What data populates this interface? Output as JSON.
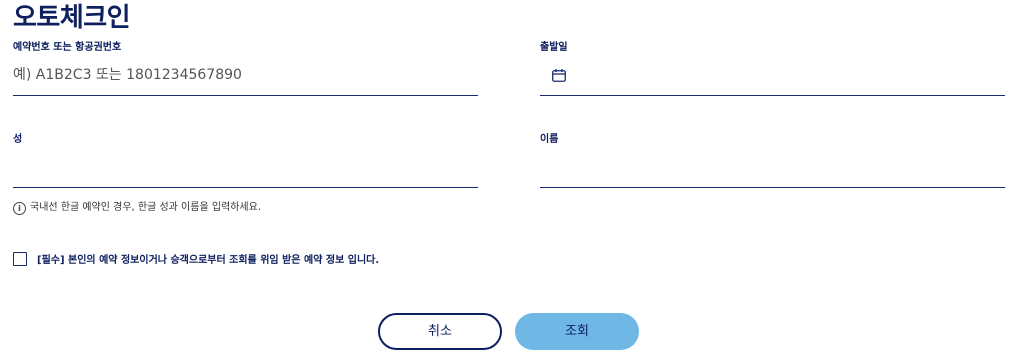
{
  "header": {
    "title": "오토체크인"
  },
  "form": {
    "reservation": {
      "label": "예약번호 또는 항공권번호",
      "placeholder": "예) A1B2C3 또는 1801234567890",
      "value": ""
    },
    "departure_date": {
      "label": "출발일",
      "value": "",
      "icon": "calendar-icon"
    },
    "last_name": {
      "label": "성",
      "value": ""
    },
    "first_name": {
      "label": "이름",
      "value": ""
    },
    "notice": {
      "icon": "info-icon",
      "text": "국내선 한글 예약인 경우, 한글 성과 이름을 입력하세요."
    },
    "consent": {
      "checked": false,
      "label": "[필수] 본인의 예약 정보이거나 승객으로부터 조회를 위임 받은 예약 정보 입니다."
    }
  },
  "actions": {
    "cancel_label": "취소",
    "search_label": "조회"
  },
  "colors": {
    "primary": "#0f2060",
    "button_accent": "#6fb8e6"
  }
}
